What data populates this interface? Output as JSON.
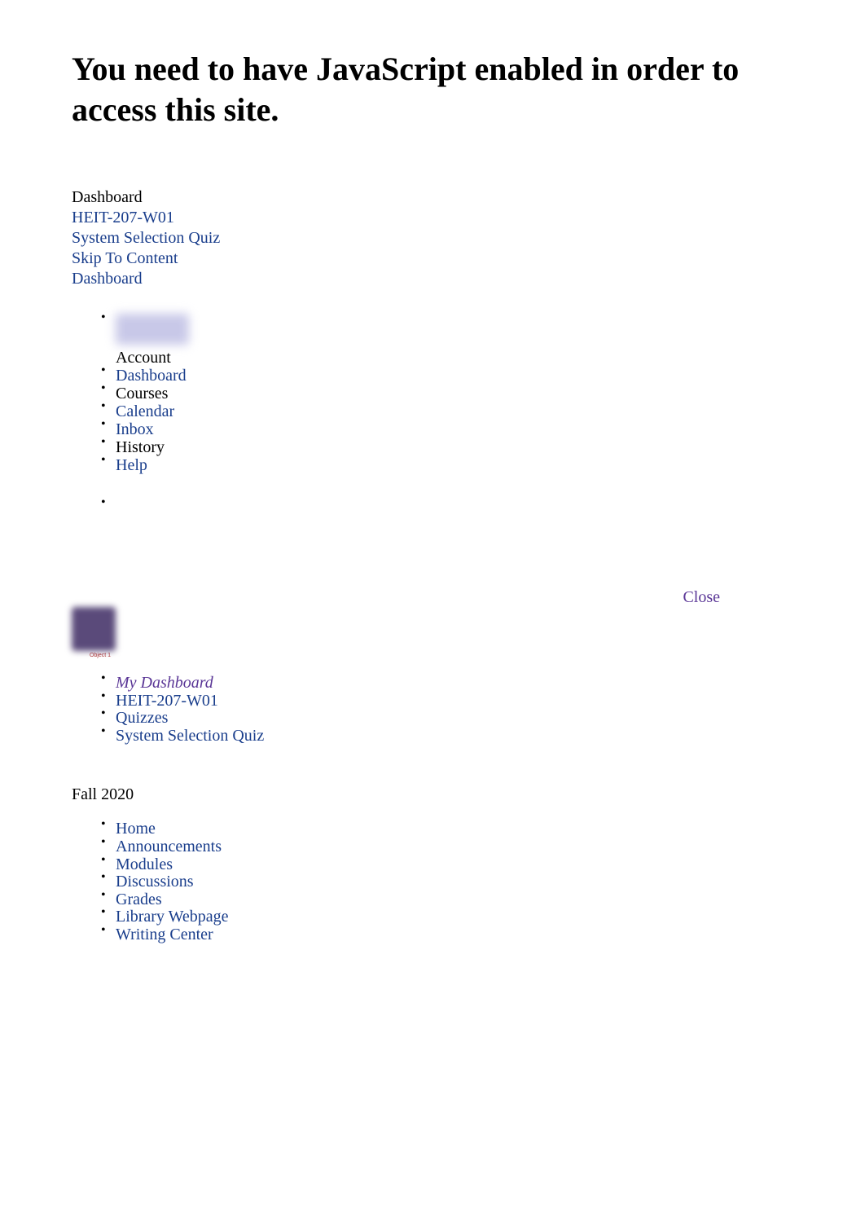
{
  "heading": "You need to have JavaScript enabled in order to access this site.",
  "breadcrumb_top": {
    "dashboard_text": "Dashboard",
    "course": "HEIT-207-W01",
    "quiz": "System Selection Quiz",
    "skip": "Skip To Content",
    "dashboard_link": "Dashboard"
  },
  "nav_main": [
    {
      "label": "Account",
      "is_link": false,
      "has_blur": true
    },
    {
      "label": "Dashboard",
      "is_link": true
    },
    {
      "label": "Courses",
      "is_link": false
    },
    {
      "label": "Calendar",
      "is_link": true
    },
    {
      "label": "Inbox",
      "is_link": true
    },
    {
      "label": "History",
      "is_link": false
    },
    {
      "label": "Help",
      "is_link": true
    }
  ],
  "close_label": "Close",
  "object_label": "Object 1",
  "breadcrumb_course": {
    "my_dashboard": "My Dashboard",
    "course": "HEIT-207-W01",
    "quizzes": "Quizzes",
    "quiz": "System Selection Quiz"
  },
  "term": "Fall 2020",
  "course_nav": [
    {
      "label": "Home"
    },
    {
      "label": "Announcements"
    },
    {
      "label": "Modules"
    },
    {
      "label": "Discussions"
    },
    {
      "label": "Grades"
    },
    {
      "label": "Library Webpage"
    },
    {
      "label": "Writing Center"
    }
  ]
}
